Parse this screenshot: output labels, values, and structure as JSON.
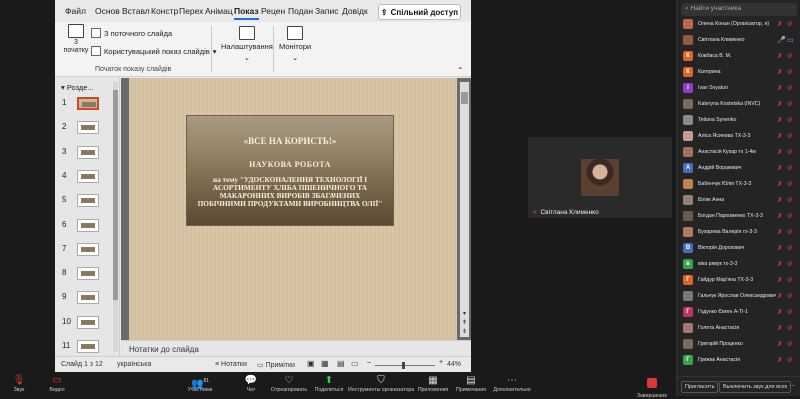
{
  "ribbon": {
    "tabs": [
      "Файл",
      "Основ",
      "Вставл",
      "Констр",
      "Перех",
      "Анімац",
      "Показ",
      "Рецен",
      "Подан",
      "Запис",
      "Довідк"
    ],
    "active_tab": "Показ",
    "share_label": "Спільний доступ",
    "start_label": "3 початку",
    "from_current": "З поточного слайда",
    "custom_show": "Користувацький показ слайдів",
    "group_label": "Початок показу слайдів",
    "narration": "Налаштування",
    "monitors": "Монітори"
  },
  "slides_panel": {
    "section": "Розде...",
    "numbers": [
      "1",
      "2",
      "3",
      "4",
      "5",
      "6",
      "7",
      "8",
      "9",
      "10",
      "11"
    ]
  },
  "slide": {
    "title": "«ВСЕ НА КОРИСТЬ!»",
    "subtitle": "НАУКОВА РОБОТА",
    "topic": "на тему \"УДОСКОНАЛЕННЯ ТЕХНОЛОГІЇ І АСОРТИМЕНТУ ХЛІБА ПШЕНИЧНОГО ТА МАКАРОННИХ ВИРОБІВ ЗБАГАЧЕНИХ ПОБІЧНИМИ ПРОДУКТАМИ ВИРОБНИЦТВА ОЛІЇ\""
  },
  "notes": {
    "label": "Нотатки до слайда"
  },
  "status": {
    "slide_counter": "Слайд 1 з 12",
    "language": "українська",
    "notes_btn": "Нотатки",
    "comments_btn": "Примітки",
    "zoom": "44%"
  },
  "video": {
    "name": "Світлана Клименко"
  },
  "participants": {
    "search_placeholder": "Найти участника",
    "list": [
      {
        "name": "Олена Конан (Організатор, я)",
        "initial": "",
        "color": "#b86b4a",
        "mic": "off",
        "cam": "off"
      },
      {
        "name": "Світлана Клименко",
        "initial": "",
        "color": "#8c5a48",
        "mic": "on",
        "cam": "on"
      },
      {
        "name": "Ковбаса В. М.",
        "initial": "К",
        "color": "#e0622b",
        "mic": "off",
        "cam": "off"
      },
      {
        "name": "Катерина",
        "initial": "К",
        "color": "#e0622b",
        "mic": "off",
        "cam": "off"
      },
      {
        "name": "Ivan Svyatun",
        "initial": "I",
        "color": "#8a3fbf",
        "mic": "off",
        "cam": "off"
      },
      {
        "name": "Kateryna Kostetska (INVC)",
        "initial": "",
        "color": "#7a6a5a",
        "mic": "off",
        "cam": "off"
      },
      {
        "name": "Tetiana Synenko",
        "initial": "",
        "color": "#8a8a8a",
        "mic": "off",
        "cam": "off"
      },
      {
        "name": "Аліса Ясинова ТХ-3-3",
        "initial": "",
        "color": "#c49a8a",
        "mic": "off",
        "cam": "off"
      },
      {
        "name": "Анастасія Кухар тх 1-4м",
        "initial": "",
        "color": "#a07060",
        "mic": "off",
        "cam": "off"
      },
      {
        "name": "Андрій Воракевич",
        "initial": "А",
        "color": "#4a6abf",
        "mic": "off",
        "cam": "off"
      },
      {
        "name": "Бабенчук Юлія ТХ-3-3",
        "initial": "",
        "color": "#c08050",
        "mic": "off",
        "cam": "off"
      },
      {
        "name": "Біляк Анна",
        "initial": "",
        "color": "#9a8070",
        "mic": "off",
        "cam": "off"
      },
      {
        "name": "Богдан Пархоменко ТХ-3-3",
        "initial": "",
        "color": "#6a5a4a",
        "mic": "off",
        "cam": "off"
      },
      {
        "name": "Бухарева Валерія тх-3-3",
        "initial": "",
        "color": "#b07a60",
        "mic": "off",
        "cam": "off"
      },
      {
        "name": "Вікторія Дорохович",
        "initial": "В",
        "color": "#4a6abf",
        "mic": "off",
        "cam": "off"
      },
      {
        "name": "віка рявук тх-3-3",
        "initial": "в",
        "color": "#3aa04a",
        "mic": "off",
        "cam": "off"
      },
      {
        "name": "Гайдур Мар'яна ТХ-3-3",
        "initial": "Г",
        "color": "#e0622b",
        "mic": "off",
        "cam": "off"
      },
      {
        "name": "Гальчук Ярослав Олександрович",
        "initial": "",
        "color": "#7a7a7a",
        "mic": "off",
        "cam": "off"
      },
      {
        "name": "Годунко Євген А-Tl-1",
        "initial": "Г",
        "color": "#c0306a",
        "mic": "off",
        "cam": "off"
      },
      {
        "name": "Голета Анастасія",
        "initial": "",
        "color": "#9a7a6a",
        "mic": "off",
        "cam": "off"
      },
      {
        "name": "Григорій Проценко",
        "initial": "",
        "color": "#7a6a5a",
        "mic": "off",
        "cam": "off"
      },
      {
        "name": "Грижак Анастасія",
        "initial": "Г",
        "color": "#3aa04a",
        "mic": "off",
        "cam": "off"
      }
    ],
    "invite_label": "Пригласить",
    "mute_all_label": "Выключить звук для всех"
  },
  "toolbar": {
    "audio": "Звук",
    "video": "Видео",
    "participants": "Участники",
    "participants_count": "81",
    "chat": "Чат",
    "react": "Отреагировать",
    "share": "Поделиться",
    "host_tools": "Инструменты организатора",
    "apps": "Приложения",
    "notes": "Примечания",
    "more": "Дополнительно",
    "end": "Завершение"
  }
}
